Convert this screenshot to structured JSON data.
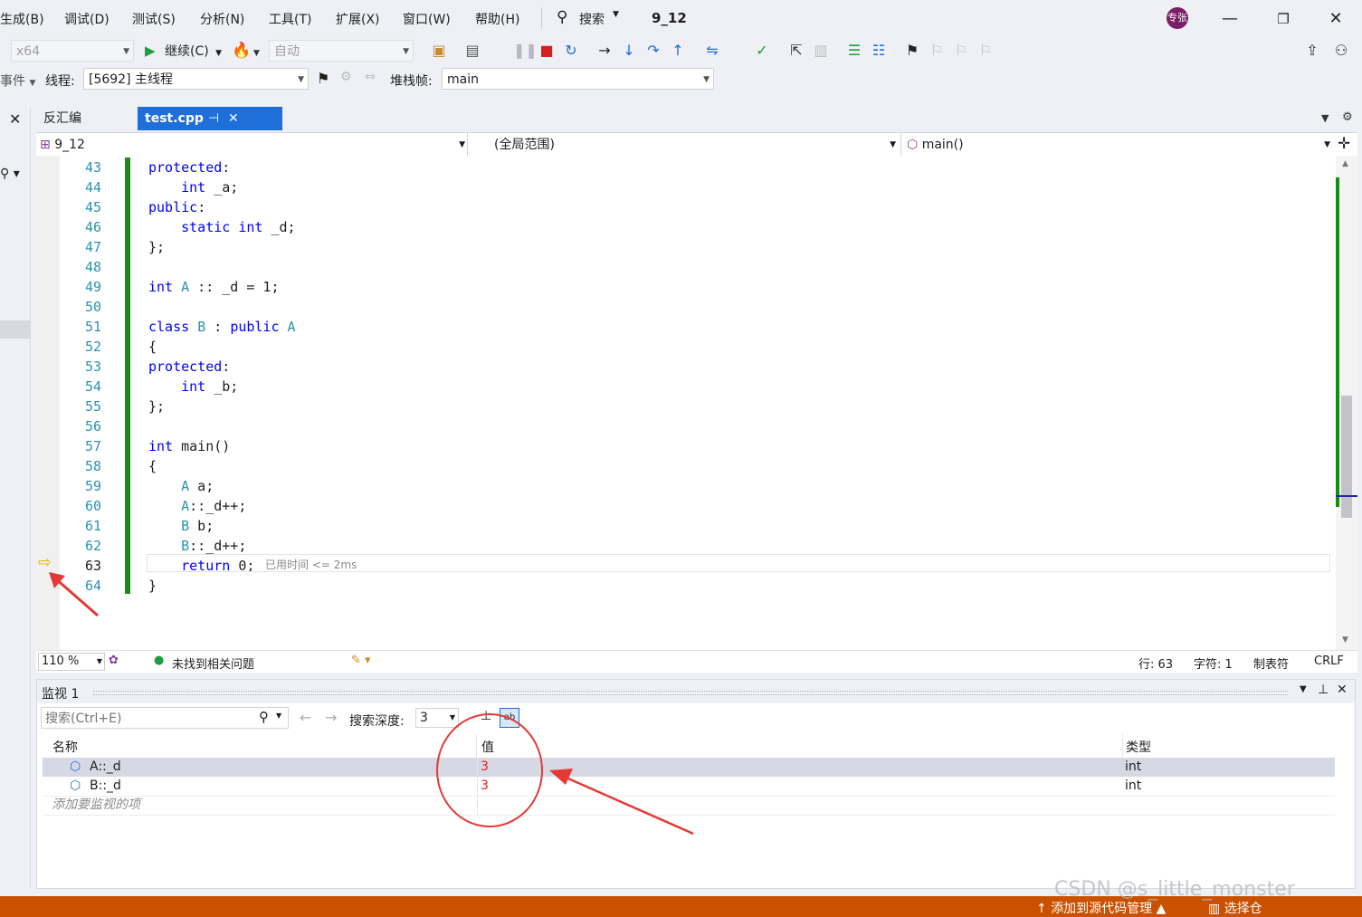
{
  "menu": [
    "生成(B)",
    "调试(D)",
    "测试(S)",
    "分析(N)",
    "工具(T)",
    "扩展(X)",
    "窗口(W)",
    "帮助(H)"
  ],
  "search_label": "搜索",
  "solution_name": "9_12",
  "user_initials": "专张",
  "toolbar": {
    "platform": "x64",
    "continue_label": "继续(C)",
    "auto_label": "自动"
  },
  "debug_location": {
    "events_label": "事件",
    "thread_label": "线程:",
    "thread_value": "[5692] 主线程",
    "stack_label": "堆栈帧:",
    "stack_value": "main"
  },
  "tabs": [
    {
      "label": "反汇编",
      "active": false
    },
    {
      "label": "test.cpp",
      "active": true
    }
  ],
  "nav": {
    "project": "9_12",
    "scope": "(全局范围)",
    "function": "main()"
  },
  "code": [
    {
      "n": "43",
      "t": "protected:"
    },
    {
      "n": "44",
      "t": "    int _a;"
    },
    {
      "n": "45",
      "t": "public:"
    },
    {
      "n": "46",
      "t": "    static int _d;"
    },
    {
      "n": "47",
      "t": "};"
    },
    {
      "n": "48",
      "t": ""
    },
    {
      "n": "49",
      "t": "int A :: _d = 1;"
    },
    {
      "n": "50",
      "t": ""
    },
    {
      "n": "51",
      "t": "class B : public A"
    },
    {
      "n": "52",
      "t": "{"
    },
    {
      "n": "53",
      "t": "protected:"
    },
    {
      "n": "54",
      "t": "    int _b;"
    },
    {
      "n": "55",
      "t": "};"
    },
    {
      "n": "56",
      "t": ""
    },
    {
      "n": "57",
      "t": "int main()"
    },
    {
      "n": "58",
      "t": "{"
    },
    {
      "n": "59",
      "t": "    A a;"
    },
    {
      "n": "60",
      "t": "    A::_d++;"
    },
    {
      "n": "61",
      "t": "    B b;"
    },
    {
      "n": "62",
      "t": "    B::_d++;"
    },
    {
      "n": "63",
      "t": "    return 0;"
    },
    {
      "n": "64",
      "t": "}"
    }
  ],
  "elapsed_hint": "已用时间 <= 2ms",
  "editor_status": {
    "zoom": "110 %",
    "issues": "未找到相关问题",
    "line": "行: 63",
    "char": "字符: 1",
    "tabs": "制表符",
    "eol": "CRLF"
  },
  "watch": {
    "title": "监视 1",
    "search_placeholder": "搜索(Ctrl+E)",
    "depth_label": "搜索深度:",
    "depth_value": "3",
    "headers": {
      "name": "名称",
      "value": "值",
      "type": "类型"
    },
    "rows": [
      {
        "name": "A::_d",
        "value": "3",
        "type": "int"
      },
      {
        "name": "B::_d",
        "value": "3",
        "type": "int"
      }
    ],
    "add_hint": "添加要监视的项"
  },
  "statusbar": {
    "source_control": "添加到源代码管理",
    "select_repo": "选择仓",
    "watermark": "CSDN @s_little_monster"
  },
  "colors": {
    "accent": "#ca5100",
    "tab_active": "#1e6fd9",
    "change_bar": "#1a8a1a",
    "value_red": "#e02020",
    "annotation_red": "#e53935"
  }
}
